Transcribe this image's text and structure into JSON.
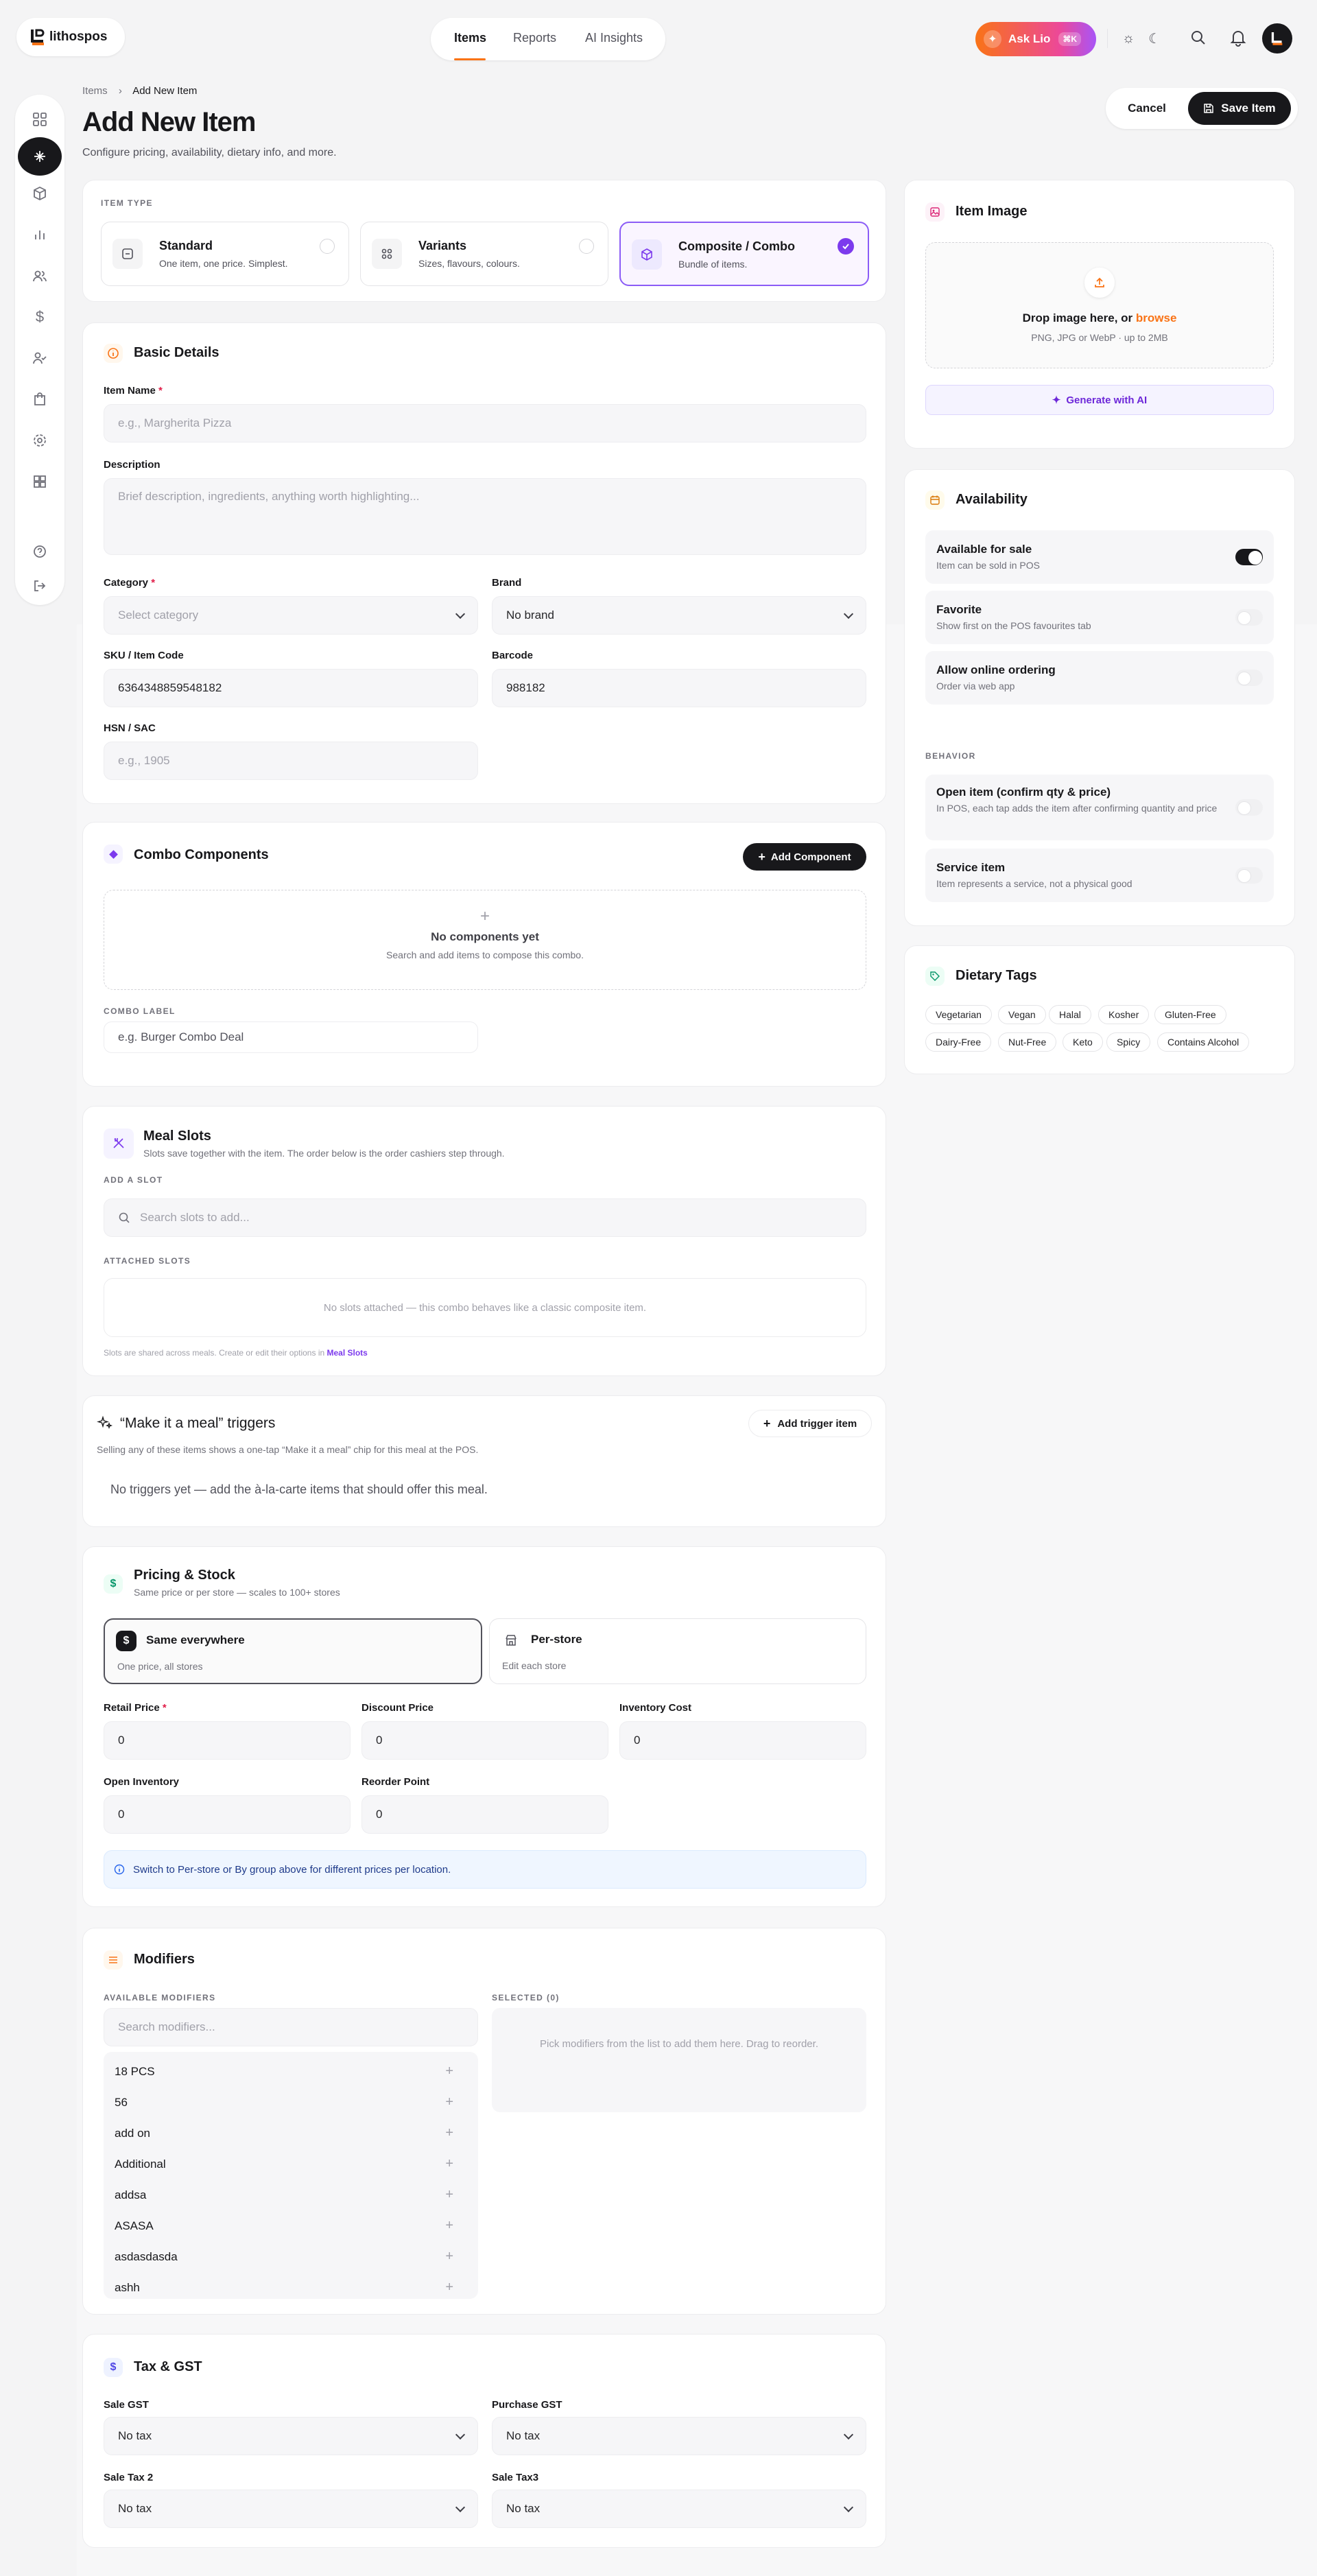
{
  "app": {
    "name": "lithospos"
  },
  "topnav": {
    "items": [
      "Items",
      "Reports",
      "AI Insights"
    ],
    "active": "Items"
  },
  "actions": {
    "ask": "Ask Lio",
    "shortcut": "⌘K"
  },
  "breadcrumb": {
    "parent": "Items",
    "current": "Add New Item"
  },
  "header": {
    "title": "Add New Item",
    "subtitle": "Configure pricing, availability, dietary info, and more.",
    "cancel": "Cancel",
    "save": "Save Item"
  },
  "item_type": {
    "caption": "ITEM TYPE",
    "options": [
      {
        "title": "Standard",
        "desc": "One item, one price. Simplest."
      },
      {
        "title": "Variants",
        "desc": "Sizes, flavours, colours."
      },
      {
        "title": "Composite / Combo",
        "desc": "Bundle of items."
      }
    ],
    "selected": "Composite / Combo"
  },
  "basic": {
    "title": "Basic Details",
    "name_label": "Item Name",
    "name_placeholder": "e.g., Margherita Pizza",
    "desc_label": "Description",
    "desc_placeholder": "Brief description, ingredients, anything worth highlighting...",
    "category_label": "Category",
    "category_value": "Select category",
    "brand_label": "Brand",
    "brand_value": "No brand",
    "sku_label": "SKU / Item Code",
    "sku_value": "6364348859548182",
    "barcode_label": "Barcode",
    "barcode_value": "988182",
    "hsn_label": "HSN / SAC",
    "hsn_placeholder": "e.g., 1905"
  },
  "combo": {
    "title": "Combo Components",
    "add": "Add Component",
    "empty_title": "No components yet",
    "empty_sub": "Search and add items to compose this combo.",
    "label_caption": "COMBO LABEL",
    "label_placeholder": "e.g. Burger Combo Deal"
  },
  "meal": {
    "title": "Meal Slots",
    "sub": "Slots save together with the item. The order below is the order cashiers step through.",
    "add_caption": "ADD A SLOT",
    "search_placeholder": "Search slots to add...",
    "attached_caption": "ATTACHED SLOTS",
    "attached_empty": "No slots attached — this combo behaves like a classic composite item.",
    "note": "Slots are shared across meals. Create or edit their options in",
    "note_link": "Meal Slots"
  },
  "triggers": {
    "title": "“Make it a meal” triggers",
    "sub": "Selling any of these items shows a one-tap “Make it a meal” chip for this meal at the POS.",
    "add": "Add trigger item",
    "empty": "No triggers yet — add the à-la-carte items that should offer this meal."
  },
  "pricing": {
    "title": "Pricing & Stock",
    "sub": "Same price or per store — scales to 100+ stores",
    "modes": [
      {
        "title": "Same everywhere",
        "desc": "One price, all stores"
      },
      {
        "title": "Per-store",
        "desc": "Edit each store"
      }
    ],
    "fields": [
      {
        "label": "Retail Price",
        "value": "0"
      },
      {
        "label": "Discount Price",
        "value": "0"
      },
      {
        "label": "Inventory Cost",
        "value": "0"
      },
      {
        "label": "Open Inventory",
        "value": "0"
      },
      {
        "label": "Reorder Point",
        "value": "0"
      }
    ],
    "info": "Switch to Per-store or By group above for different prices per location."
  },
  "modifiers": {
    "title": "Modifiers",
    "available_caption": "AVAILABLE MODIFIERS",
    "selected_caption": "SELECTED (0)",
    "search_placeholder": "Search modifiers...",
    "items": [
      "18 PCS",
      "56",
      "add on",
      "Additional",
      "addsa",
      "ASASA",
      "asdasdasda",
      "ashh"
    ],
    "selected_empty": "Pick modifiers from the list to add them here. Drag to reorder."
  },
  "tax": {
    "title": "Tax & GST",
    "fields": [
      {
        "label": "Sale GST",
        "value": "No tax"
      },
      {
        "label": "Purchase GST",
        "value": "No tax"
      },
      {
        "label": "Sale Tax 2",
        "value": "No tax"
      },
      {
        "label": "Sale Tax3",
        "value": "No tax"
      }
    ]
  },
  "image": {
    "title": "Item Image",
    "drop": "Drop image here, or",
    "browse": "browse",
    "hint": "PNG, JPG or WebP · up to 2MB",
    "generate": "Generate with AI"
  },
  "availability": {
    "title": "Availability",
    "rows": [
      {
        "title": "Available for sale",
        "desc": "Item can be sold in POS",
        "on": true
      },
      {
        "title": "Favorite",
        "desc": "Show first on the POS favourites tab",
        "on": false
      },
      {
        "title": "Allow online ordering",
        "desc": "Order via web app",
        "on": false
      }
    ],
    "behavior_caption": "BEHAVIOR",
    "behavior": [
      {
        "title": "Open item (confirm qty & price)",
        "desc": "In POS, each tap adds the item after confirming quantity and price",
        "on": false
      },
      {
        "title": "Service item",
        "desc": "Item represents a service, not a physical good",
        "on": false
      }
    ]
  },
  "dietary": {
    "title": "Dietary Tags",
    "tags": [
      "Vegetarian",
      "Vegan",
      "Halal",
      "Kosher",
      "Gluten-Free",
      "Dairy-Free",
      "Nut-Free",
      "Keto",
      "Spicy",
      "Contains Alcohol"
    ]
  },
  "colors": {
    "accent": "#f97316",
    "purple": "#7c3aed",
    "dark": "#18181b"
  }
}
